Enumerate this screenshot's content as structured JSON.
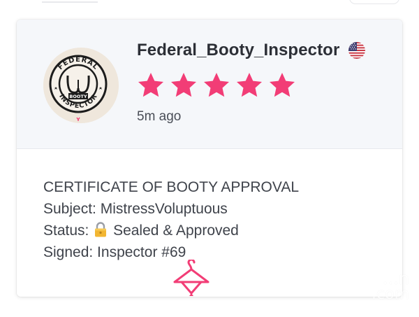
{
  "review": {
    "username": "Federal_Booty_Inspector",
    "country_flag": "us-flag-icon",
    "rating": 5,
    "rating_max": 5,
    "star_color": "#f23d76",
    "timestamp": "5m ago",
    "avatar": {
      "badge_top_text": "FEDERAL",
      "badge_center_text": "BOOTY",
      "badge_bottom_text": "INSPECTOR"
    },
    "body_lines": [
      "CERTIFICATE OF BOOTY APPROVAL",
      "Subject: MistressVoluptuous",
      "Sealed & Approved",
      "Signed: Inspector #69"
    ],
    "status_prefix": "Status:"
  },
  "colors": {
    "accent_pink": "#f23d76",
    "header_bg": "#f5f7fa",
    "text_dark": "#2c2f36",
    "text_body": "#3f434b"
  },
  "watermark": {
    "line1": "...n",
    "line2": ".com"
  }
}
